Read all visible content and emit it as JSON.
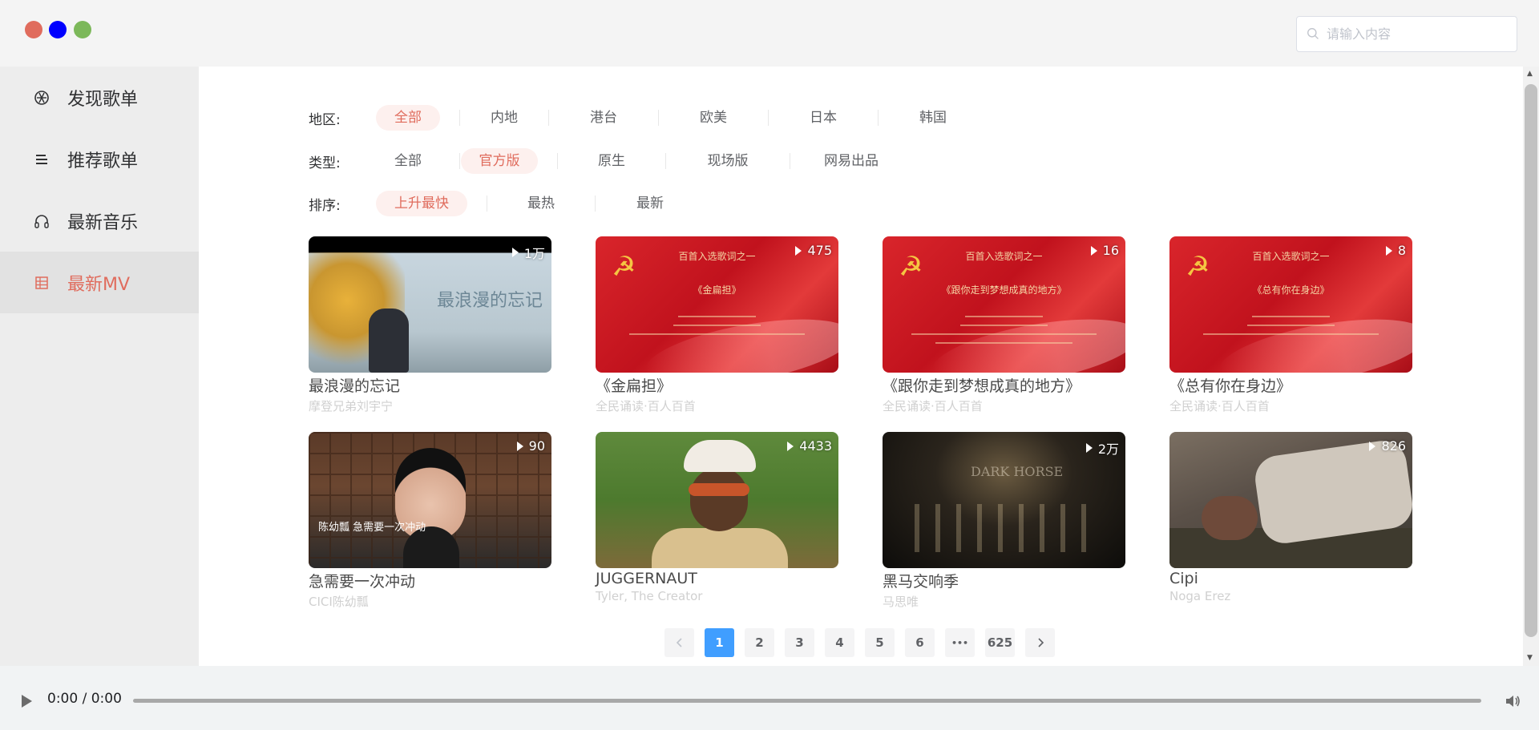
{
  "search": {
    "placeholder": "请输入内容"
  },
  "sidebar": {
    "items": [
      {
        "label": "发现歌单",
        "icon": "disc-icon"
      },
      {
        "label": "推荐歌单",
        "icon": "list-icon"
      },
      {
        "label": "最新音乐",
        "icon": "headphones-icon"
      },
      {
        "label": "最新MV",
        "icon": "grid-icon",
        "active": true
      }
    ]
  },
  "filters": {
    "area": {
      "label": "地区:",
      "options": [
        "全部",
        "内地",
        "港台",
        "欧美",
        "日本",
        "韩国"
      ],
      "selected": "全部"
    },
    "type": {
      "label": "类型:",
      "options": [
        "全部",
        "官方版",
        "原生",
        "现场版",
        "网易出品"
      ],
      "selected": "官方版"
    },
    "order": {
      "label": "排序:",
      "options": [
        "上升最快",
        "最热",
        "最新"
      ],
      "selected": "上升最快"
    }
  },
  "mvs": [
    {
      "title": "最浪漫的忘记",
      "artist": "摩登兄弟刘宇宁",
      "plays": "1万",
      "thumb_text": "最浪漫的忘记"
    },
    {
      "title": "《金扁担》",
      "artist": "全民诵读·百人百首",
      "plays": "475",
      "banner_title": "百首入选歌词之一",
      "banner_sub": "《金扁担》"
    },
    {
      "title": "《跟你走到梦想成真的地方》",
      "artist": "全民诵读·百人百首",
      "plays": "16",
      "banner_title": "百首入选歌词之一",
      "banner_sub": "《跟你走到梦想成真的地方》"
    },
    {
      "title": "《总有你在身边》",
      "artist": "全民诵读·百人百首",
      "plays": "8",
      "banner_title": "百首入选歌词之一",
      "banner_sub": "《总有你在身边》"
    },
    {
      "title": "急需要一次冲动",
      "artist": "CICI陈幼瓢",
      "plays": "90",
      "thumb_text": "陈幼瓢 急需要一次冲动"
    },
    {
      "title": "JUGGERNAUT",
      "artist": "Tyler, The Creator",
      "plays": "4433"
    },
    {
      "title": "黑马交响季",
      "artist": "马思唯",
      "plays": "2万",
      "thumb_text": "DARK HORSE"
    },
    {
      "title": "Cipi",
      "artist": "Noga Erez",
      "plays": "826"
    }
  ],
  "pagination": {
    "pages": [
      "1",
      "2",
      "3",
      "4",
      "5",
      "6"
    ],
    "ellipsis": "•••",
    "last": "625",
    "current": "1"
  },
  "player": {
    "time": "0:00 / 0:00"
  },
  "colors": {
    "accent": "#e06c5d",
    "page_active": "#409eff"
  }
}
